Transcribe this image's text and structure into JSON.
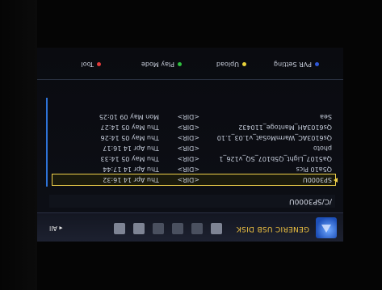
{
  "header": {
    "title": "GENERIC USB DISK",
    "all_label": "All"
  },
  "path": "/C/SP3000U",
  "files": [
    {
      "name": "SP3000U",
      "type": "<DIR>",
      "date": "Thu Apr 14 16:32",
      "selected": true
    },
    {
      "name": "Q5a10 Pics",
      "type": "<DIR>",
      "date": "Thu Apr 14 17:44",
      "selected": false
    },
    {
      "name": "Qa5107_Light_Q5b107_SQ_v126_1",
      "type": "<DIR>",
      "date": "Thu May 05 14:33",
      "selected": false
    },
    {
      "name": "photo",
      "type": "<DIR>",
      "date": "Thu Apr 14 16:17",
      "selected": false
    },
    {
      "name": "Qs6103AC_WarmMoSat_v1.03_1.10",
      "type": "<DIR>",
      "date": "Thu May 05 14:26",
      "selected": false
    },
    {
      "name": "Qs6103AH_Mantoge_110432",
      "type": "<DIR>",
      "date": "Thu May 05 14:27",
      "selected": false
    },
    {
      "name": "Sea",
      "type": "<DIR>",
      "date": "Mon May 09 10:25",
      "selected": false
    }
  ],
  "legend": [
    {
      "label": "Tool",
      "color": "#e23a3a"
    },
    {
      "label": "Play Mode",
      "color": "#2fbf3f"
    },
    {
      "label": "Upload",
      "color": "#e8d23a"
    },
    {
      "label": "PVR Setting",
      "color": "#2f58d8"
    }
  ]
}
